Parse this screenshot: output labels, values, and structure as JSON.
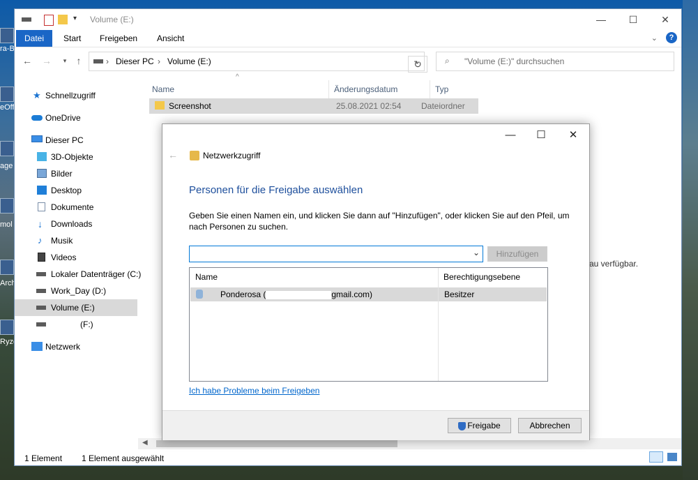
{
  "explorer": {
    "title": "Volume (E:)",
    "tabs": [
      "Datei",
      "Start",
      "Freigeben",
      "Ansicht"
    ],
    "address": {
      "crumbs": [
        "Dieser PC",
        "Volume (E:)"
      ]
    },
    "search_placeholder": "\"Volume (E:)\" durchsuchen",
    "nav": [
      {
        "label": "Schnellzugriff",
        "icon": "star-icon"
      },
      {
        "label": "OneDrive",
        "icon": "cloud-icon"
      },
      {
        "label": "Dieser PC",
        "icon": "computer-icon"
      },
      {
        "label": "3D-Objekte",
        "icon": "cube-icon"
      },
      {
        "label": "Bilder",
        "icon": "pictures-icon"
      },
      {
        "label": "Desktop",
        "icon": "desktop-icon"
      },
      {
        "label": "Dokumente",
        "icon": "documents-icon"
      },
      {
        "label": "Downloads",
        "icon": "download-icon"
      },
      {
        "label": "Musik",
        "icon": "music-icon"
      },
      {
        "label": "Videos",
        "icon": "video-icon"
      },
      {
        "label": "Lokaler Datenträger (C:)",
        "icon": "drive-icon"
      },
      {
        "label": "Work_Day (D:)",
        "icon": "drive-icon"
      },
      {
        "label": "Volume (E:)",
        "icon": "drive-icon"
      },
      {
        "label": "(F:)",
        "icon": "drive-icon"
      },
      {
        "label": "Netzwerk",
        "icon": "network-icon"
      }
    ],
    "columns": [
      "Name",
      "Änderungsdatum",
      "Typ"
    ],
    "files": [
      {
        "name": "Screenshot",
        "date": "25.08.2021 02:54",
        "type": "Dateiordner"
      }
    ],
    "side_text": "au verfügbar.",
    "status": {
      "count": "1 Element",
      "selected": "1 Element ausgewählt"
    }
  },
  "dialog": {
    "title": "Netzwerkzugriff",
    "heading": "Personen für die Freigabe auswählen",
    "description": "Geben Sie einen Namen ein, und klicken Sie dann auf \"Hinzufügen\", oder klicken Sie auf den Pfeil, um nach Personen zu suchen.",
    "add_button": "Hinzufügen",
    "list_columns": [
      "Name",
      "Berechtigungsebene"
    ],
    "people": [
      {
        "name_start": "Ponderosa (",
        "name_end": "gmail.com)",
        "level": "Besitzer"
      }
    ],
    "help_link": "Ich habe Probleme beim Freigeben",
    "share_button": "Freigabe",
    "cancel_button": "Abbrechen"
  },
  "desktop": {
    "labels": [
      "ra-B",
      "eOff",
      "age",
      "mol",
      "Arch",
      "Ryze"
    ]
  }
}
